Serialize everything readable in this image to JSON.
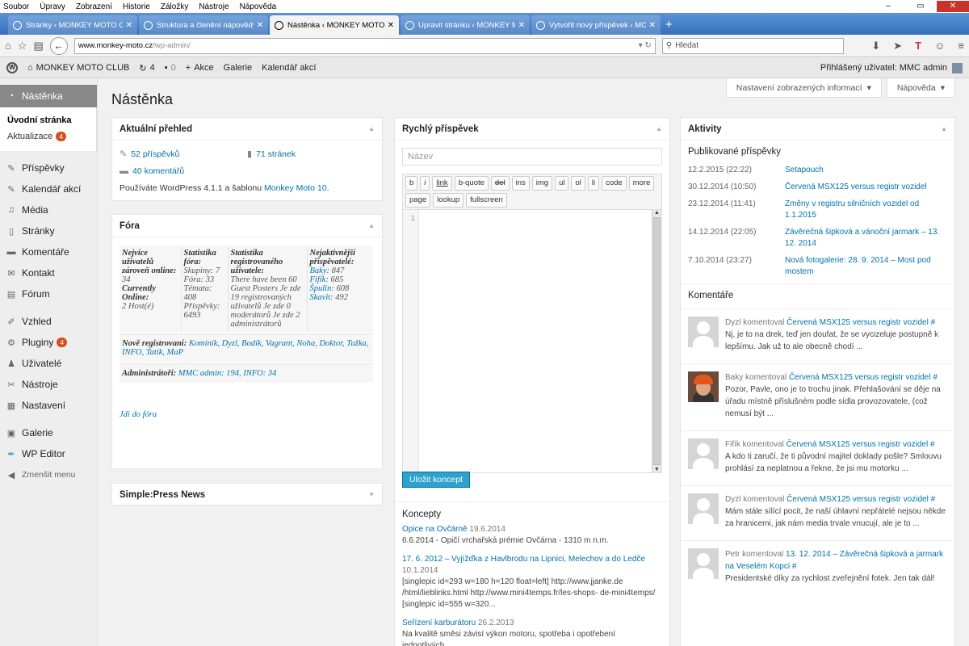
{
  "browser": {
    "menu": [
      "Soubor",
      "Úpravy",
      "Zobrazení",
      "Historie",
      "Záložky",
      "Nástroje",
      "Nápověda"
    ],
    "tabs": [
      {
        "title": "Stránky ‹ MONKEY MOTO CLUB — WordPress",
        "active": false
      },
      {
        "title": "Struktura a členění nápovědy — Page",
        "active": false
      },
      {
        "title": "Nástěnka ‹ MONKEY MOTO CLUB",
        "active": true
      },
      {
        "title": "Upravit stránku ‹ MONKEY MOTO CLUB",
        "active": false
      },
      {
        "title": "Vytvořit nový příspěvek ‹ MONKEY",
        "active": false
      }
    ],
    "url_host": "www.monkey-moto.cz",
    "url_path": "/wp-admin/",
    "search_placeholder": "Hledat"
  },
  "adminbar": {
    "site_name": "MONKEY MOTO CLUB",
    "updates": "4",
    "comments": "0",
    "new_label": "Akce",
    "gallery": "Galerie",
    "calendar": "Kalendář akcí",
    "user": "Přihlášený uživatel: MMC admin"
  },
  "sidebar": {
    "current": "Nástěnka",
    "submenu": [
      {
        "label": "Úvodní stránka"
      },
      {
        "label": "Aktualizace",
        "badge": "4"
      }
    ],
    "group1": [
      {
        "label": "Příspěvky",
        "icon": "pin-icon"
      },
      {
        "label": "Kalendář akcí",
        "icon": "pin-icon"
      },
      {
        "label": "Média",
        "icon": "media-icon"
      },
      {
        "label": "Stránky",
        "icon": "page-icon"
      },
      {
        "label": "Komentáře",
        "icon": "comment-icon"
      },
      {
        "label": "Kontakt",
        "icon": "mail-icon"
      },
      {
        "label": "Fórum",
        "icon": "forum-icon"
      }
    ],
    "group2": [
      {
        "label": "Vzhled",
        "icon": "brush-icon"
      },
      {
        "label": "Pluginy",
        "icon": "plugin-icon",
        "badge": "4"
      },
      {
        "label": "Uživatelé",
        "icon": "user-icon"
      },
      {
        "label": "Nástroje",
        "icon": "wrench-icon"
      },
      {
        "label": "Nastavení",
        "icon": "settings-icon"
      }
    ],
    "group3": [
      {
        "label": "Galerie",
        "icon": "gallery-icon"
      },
      {
        "label": "WP Editor",
        "icon": "editor-icon"
      }
    ],
    "collapse": "Zmenšit menu"
  },
  "page": {
    "title": "Nástěnka",
    "screen_options": "Nastavení zobrazených informací",
    "help": "Nápověda"
  },
  "glance": {
    "title": "Aktuální přehled",
    "posts": "52 příspěvků",
    "pages": "71 stránek",
    "comments": "40 komentářů",
    "info_prefix": "Používáte WordPress 4.1.1 a šablonu ",
    "theme": "Monkey Moto 10",
    "info_suffix": "."
  },
  "forum": {
    "title": "Fóra",
    "c1_title": "Nejvíce uživatelů zároveň online:",
    "c1_val": "34",
    "c1_title2": "Currently Online:",
    "c1_val2": "2 Host(é)",
    "c2_title": "Statistika fóra:",
    "c2_lines": "Skupiny: 7 Fóra: 33 Témata: 408 Příspěvky: 6493",
    "c3_title": "Statistika registrovaného uživatele:",
    "c3_lines": "There have been 60 Guest Posters Je zde 19 registrovaných uživatelů Je zde 0 moderátorů Je zde 2 administrátorů",
    "c4_title": "Nejaktivnější přispěvatelé:",
    "top": [
      {
        "name": "Baky",
        "n": "847"
      },
      {
        "name": "Fifík",
        "n": "685"
      },
      {
        "name": "Špulin",
        "n": "608"
      },
      {
        "name": "Skavit",
        "n": "492"
      }
    ],
    "new_label": "Nově registrovaní:",
    "new_users": "Kominík, Dyzl, Bodík, Vagrant, Noha, Doktor, Tužka, INFO, Tatík, MaP",
    "admins_label": "Administrátoři:",
    "admins": "MMC admin: 194, INFO: 34",
    "link": "Jdi do fóra"
  },
  "sp_news": {
    "title": "Simple:Press News"
  },
  "quickpost": {
    "title": "Rychlý příspěvek",
    "name_placeholder": "Název",
    "buttons": [
      "b",
      "i",
      "link",
      "b-quote",
      "del",
      "ins",
      "img",
      "ul",
      "ol",
      "li",
      "code",
      "more",
      "page",
      "lookup",
      "fullscreen"
    ],
    "line_no": "1",
    "save": "Uložit koncept",
    "drafts_title": "Koncepty",
    "drafts": [
      {
        "title": "Opice na Ovčárně",
        "date": "19.6.2014",
        "text": "6.6.2014 - Opičí vrchařská prémie Ovčárna - 1310 m n.m."
      },
      {
        "title": "17. 6. 2012 – Vyjížďka z Havlbrodu na Lipnici, Melechov a do Ledče",
        "date": "10.1.2014",
        "text": "[singlepic id=293 w=180 h=120 float=left] http://www.jjanke.de /html/lieblinks.html http://www.mini4temps.fr/les-shops- de-mini4temps/ [singlepic id=555 w=320..."
      },
      {
        "title": "Seřízení karburátoru",
        "date": "26.2.2013",
        "text": "Na kvalitě směsi závisí výkon motoru, spotřeba i opotřebení jednotlivých..."
      }
    ]
  },
  "activity": {
    "title": "Aktivity",
    "published_title": "Publikované příspěvky",
    "published": [
      {
        "date": "12.2.2015 (22:22)",
        "title": "Setapouch"
      },
      {
        "date": "30.12.2014 (10:50)",
        "title": "Červená MSX125 versus registr vozidel"
      },
      {
        "date": "23.12.2014 (11:41)",
        "title": "Změny v registru silničních vozidel od 1.1.2015"
      },
      {
        "date": "14.12.2014 (22:05)",
        "title": "Závěrečná šipková a vánoční jarmark – 13. 12. 2014"
      },
      {
        "date": "7.10.2014 (23:27)",
        "title": "Nová fotogalerie: 28. 9. 2014 – Most pod mostem"
      }
    ],
    "comments_title": "Komentáře",
    "comments": [
      {
        "author": "Dyzl",
        "verb": " komentoval ",
        "post": "Červená MSX125 versus registr vozidel #",
        "text": "Nj, je to na drek, teď jen doufat, že se vycizeluje postupně k lepšímu. Jak už to ale obecně chodí ...",
        "photo": false
      },
      {
        "author": "Baky",
        "verb": " komentoval ",
        "post": "Červená MSX125 versus registr vozidel #",
        "text": "Pozor, Pavle, ono je to trochu jinak. Přehlašování se děje na úřadu místně příslušném podle sídla provozovatele, (což nemusí být ...",
        "photo": true
      },
      {
        "author": "Fifík",
        "verb": " komentoval ",
        "post": "Červená MSX125 versus registr vozidel #",
        "text": "A kdo ti zaručí, že ti původní majitel doklady pošle? Smlouvu prohlásí za neplatnou a řekne, že jsi mu motorku ...",
        "photo": false
      },
      {
        "author": "Dyzl",
        "verb": " komentoval ",
        "post": "Červená MSX125 versus registr vozidel #",
        "text": "Mám stále sílící pocit, že naší úhlavní nepřátelé nejsou někde za hranicemi, jak nám media trvale vnucují, ale je to ...",
        "photo": false
      },
      {
        "author": "Petr",
        "verb": " komentoval ",
        "post": "13. 12. 2014 – Závěrečná šipková a jarmark na Veselém Kopci #",
        "text": "Presidentské díky za rychlost zveřejnění fotek. Jen tak dál!",
        "photo": false
      }
    ]
  },
  "colors": {
    "link": "#0073aa",
    "tabbar": "#3e7fce",
    "button": "#2ea2cc",
    "badge": "#d54e21"
  }
}
